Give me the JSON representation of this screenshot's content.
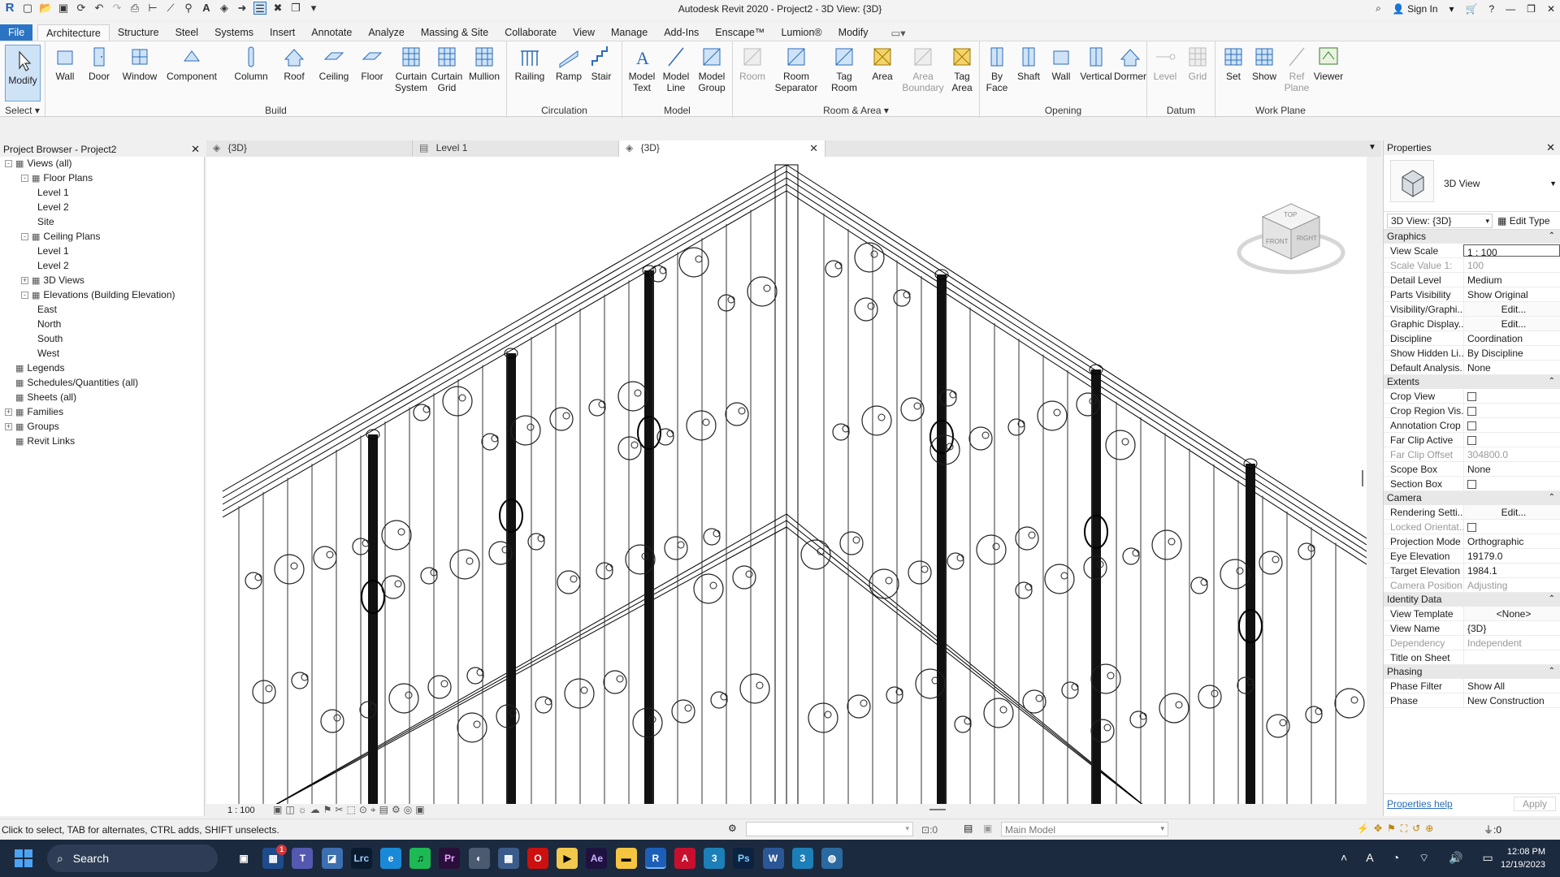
{
  "app": {
    "title": "Autodesk Revit 2020 - Project2 - 3D View: {3D}",
    "sign_in": "Sign In"
  },
  "ribbon_tabs": [
    "File",
    "Architecture",
    "Structure",
    "Steel",
    "Systems",
    "Insert",
    "Annotate",
    "Analyze",
    "Massing & Site",
    "Collaborate",
    "View",
    "Manage",
    "Add-Ins",
    "Enscape™",
    "Lumion®",
    "Modify"
  ],
  "ribbon": {
    "select_label": "Select",
    "groups": {
      "build": "Build",
      "circulation": "Circulation",
      "model": "Model",
      "room_area": "Room & Area",
      "opening": "Opening",
      "datum": "Datum",
      "work_plane": "Work Plane"
    },
    "buttons": {
      "modify": "Modify",
      "wall": "Wall",
      "door": "Door",
      "window": "Window",
      "component": "Component",
      "column": "Column",
      "roof": "Roof",
      "ceiling": "Ceiling",
      "floor": "Floor",
      "curtain_system": [
        "Curtain",
        "System"
      ],
      "curtain_grid": [
        "Curtain",
        "Grid"
      ],
      "mullion": "Mullion",
      "railing": "Railing",
      "ramp": "Ramp",
      "stair": "Stair",
      "model_text": [
        "Model",
        "Text"
      ],
      "model_line": [
        "Model",
        "Line"
      ],
      "model_group": [
        "Model",
        "Group"
      ],
      "room": "Room",
      "room_separator": [
        "Room",
        "Separator"
      ],
      "tag_room": [
        "Tag",
        "Room"
      ],
      "area": "Area",
      "area_boundary": [
        "Area",
        "Boundary"
      ],
      "tag_area": [
        "Tag",
        "Area"
      ],
      "by_face": [
        "By",
        "Face"
      ],
      "shaft": "Shaft",
      "wall_opening": "Wall",
      "vertical": "Vertical",
      "dormer": "Dormer",
      "level": "Level",
      "grid": "Grid",
      "set": "Set",
      "show": "Show",
      "ref_plane": [
        "Ref",
        "Plane"
      ],
      "viewer": "Viewer"
    }
  },
  "project_browser": {
    "title": "Project Browser - Project2",
    "items": [
      {
        "label": "Views (all)",
        "depth": 0,
        "toggle": "-"
      },
      {
        "label": "Floor Plans",
        "depth": 1,
        "toggle": "-"
      },
      {
        "label": "Level 1",
        "depth": 2
      },
      {
        "label": "Level 2",
        "depth": 2
      },
      {
        "label": "Site",
        "depth": 2
      },
      {
        "label": "Ceiling Plans",
        "depth": 1,
        "toggle": "-"
      },
      {
        "label": "Level 1",
        "depth": 2
      },
      {
        "label": "Level 2",
        "depth": 2
      },
      {
        "label": "3D Views",
        "depth": 1,
        "toggle": "+"
      },
      {
        "label": "Elevations (Building Elevation)",
        "depth": 1,
        "toggle": "-"
      },
      {
        "label": "East",
        "depth": 2
      },
      {
        "label": "North",
        "depth": 2
      },
      {
        "label": "South",
        "depth": 2
      },
      {
        "label": "West",
        "depth": 2
      },
      {
        "label": "Legends",
        "depth": 0
      },
      {
        "label": "Schedules/Quantities (all)",
        "depth": 0
      },
      {
        "label": "Sheets (all)",
        "depth": 0
      },
      {
        "label": "Families",
        "depth": 0,
        "toggle": "+"
      },
      {
        "label": "Groups",
        "depth": 0,
        "toggle": "+"
      },
      {
        "label": "Revit Links",
        "depth": 0
      }
    ]
  },
  "view_tabs": [
    "{3D}",
    "Level 1",
    "{3D}"
  ],
  "viewcube": {
    "top": "TOP",
    "front": "FRONT",
    "right": "RIGHT"
  },
  "view_scale": "1 : 100",
  "properties": {
    "title": "Properties",
    "type": "3D View",
    "selector": "3D View: {3D}",
    "edit_type": "Edit Type",
    "sections": [
      {
        "name": "Graphics",
        "rows": [
          {
            "k": "View Scale",
            "v": "1 : 100"
          },
          {
            "k": "Scale Value    1:",
            "v": "100",
            "dim": true
          },
          {
            "k": "Detail Level",
            "v": "Medium"
          },
          {
            "k": "Parts Visibility",
            "v": "Show Original"
          },
          {
            "k": "Visibility/Graphi...",
            "v": "Edit...",
            "btn": true
          },
          {
            "k": "Graphic Display...",
            "v": "Edit...",
            "btn": true
          },
          {
            "k": "Discipline",
            "v": "Coordination"
          },
          {
            "k": "Show Hidden Li...",
            "v": "By Discipline"
          },
          {
            "k": "Default Analysis...",
            "v": "None"
          }
        ]
      },
      {
        "name": "Extents",
        "rows": [
          {
            "k": "Crop View",
            "cb": true
          },
          {
            "k": "Crop Region Vis...",
            "cb": true
          },
          {
            "k": "Annotation Crop",
            "cb": true
          },
          {
            "k": "Far Clip Active",
            "cb": true
          },
          {
            "k": "Far Clip Offset",
            "v": "304800.0",
            "dim": true
          },
          {
            "k": "Scope Box",
            "v": "None"
          },
          {
            "k": "Section Box",
            "cb": true
          }
        ]
      },
      {
        "name": "Camera",
        "rows": [
          {
            "k": "Rendering Setti...",
            "v": "Edit...",
            "btn": true
          },
          {
            "k": "Locked Orientat...",
            "cb": true,
            "dim": true
          },
          {
            "k": "Projection Mode",
            "v": "Orthographic"
          },
          {
            "k": "Eye Elevation",
            "v": "19179.0"
          },
          {
            "k": "Target Elevation",
            "v": "1984.1"
          },
          {
            "k": "Camera Position",
            "v": "Adjusting",
            "dim": true
          }
        ]
      },
      {
        "name": "Identity Data",
        "rows": [
          {
            "k": "View Template",
            "v": "<None>",
            "btn": true
          },
          {
            "k": "View Name",
            "v": "{3D}"
          },
          {
            "k": "Dependency",
            "v": "Independent",
            "dim": true
          },
          {
            "k": "Title on Sheet",
            "v": ""
          }
        ]
      },
      {
        "name": "Phasing",
        "rows": [
          {
            "k": "Phase Filter",
            "v": "Show All"
          },
          {
            "k": "Phase",
            "v": "New Construction"
          }
        ]
      }
    ],
    "help": "Properties help",
    "apply": "Apply"
  },
  "status": {
    "message": "Click to select, TAB for alternates, CTRL adds, SHIFT unselects.",
    "count": ":0",
    "model": "Main Model",
    "filter": ":0"
  },
  "taskbar": {
    "search": "Search",
    "time": "12:08 PM",
    "date": "12/19/2023",
    "badge": "1"
  }
}
